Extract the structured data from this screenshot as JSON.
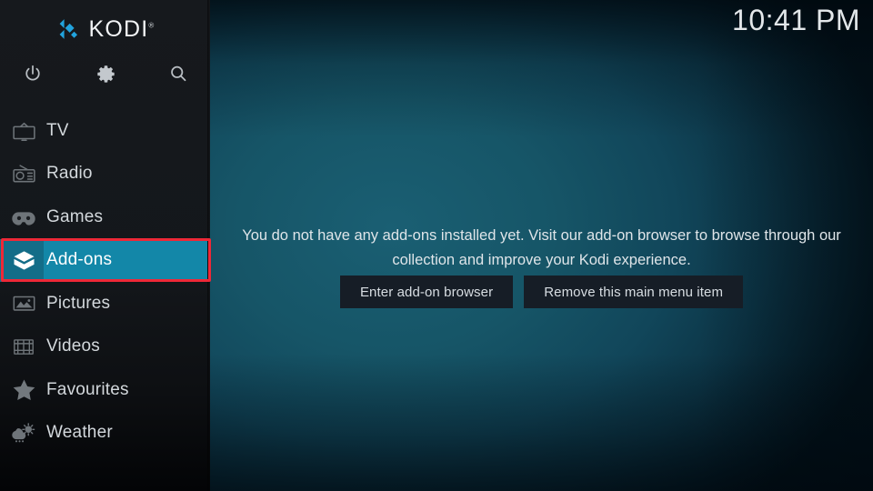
{
  "app": {
    "brand_name": "KODI",
    "brand_tm": "®",
    "accent_color": "#1387a8",
    "accent_icon_color": "#136d88",
    "annotation_color": "#ef2837",
    "logo_color": "#22a3dd"
  },
  "header": {
    "clock": "10:41 PM"
  },
  "top_icons": [
    {
      "name": "power-icon",
      "label": "Power"
    },
    {
      "name": "gear-icon",
      "label": "Settings"
    },
    {
      "name": "search-icon",
      "label": "Search"
    }
  ],
  "sidebar": {
    "items": [
      {
        "label": "TV",
        "icon": "tv-icon",
        "selected": false
      },
      {
        "label": "Radio",
        "icon": "radio-icon",
        "selected": false
      },
      {
        "label": "Games",
        "icon": "gamepad-icon",
        "selected": false
      },
      {
        "label": "Add-ons",
        "icon": "addons-box-icon",
        "selected": true
      },
      {
        "label": "Pictures",
        "icon": "picture-icon",
        "selected": false
      },
      {
        "label": "Videos",
        "icon": "film-icon",
        "selected": false
      },
      {
        "label": "Favourites",
        "icon": "star-icon",
        "selected": false
      },
      {
        "label": "Weather",
        "icon": "weather-icon",
        "selected": false
      }
    ]
  },
  "main": {
    "empty_message": "You do not have any add-ons installed yet. Visit our add-on browser to browse through our collection and improve your Kodi experience.",
    "buttons": [
      {
        "label": "Enter add-on browser"
      },
      {
        "label": "Remove this main menu item"
      }
    ]
  }
}
